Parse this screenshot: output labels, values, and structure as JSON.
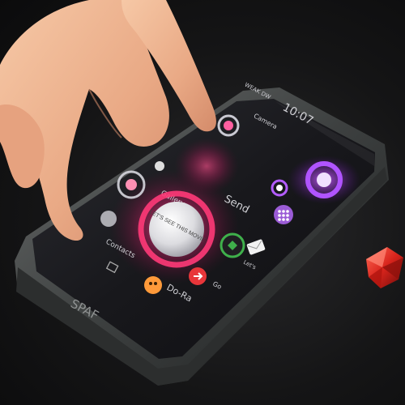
{
  "phone": {
    "brand": "SPAF",
    "status_left": "WEAK DW",
    "clock": "10:07"
  },
  "screen": {
    "center_button": "LET'S SEE THIS MOVIE",
    "labels": {
      "top_right": "Camera",
      "left_upper": "Gallery",
      "left_lower": "Contacts",
      "send": "Send",
      "let": "Let's",
      "go": "Go",
      "dora": "Do-Ra"
    }
  },
  "colors": {
    "accent_pink": "#ff3a78",
    "accent_purple": "#a53cff",
    "accent_orange": "#ff9a3a",
    "accent_green": "#3fb04b",
    "gem_red": "#d8241c"
  }
}
